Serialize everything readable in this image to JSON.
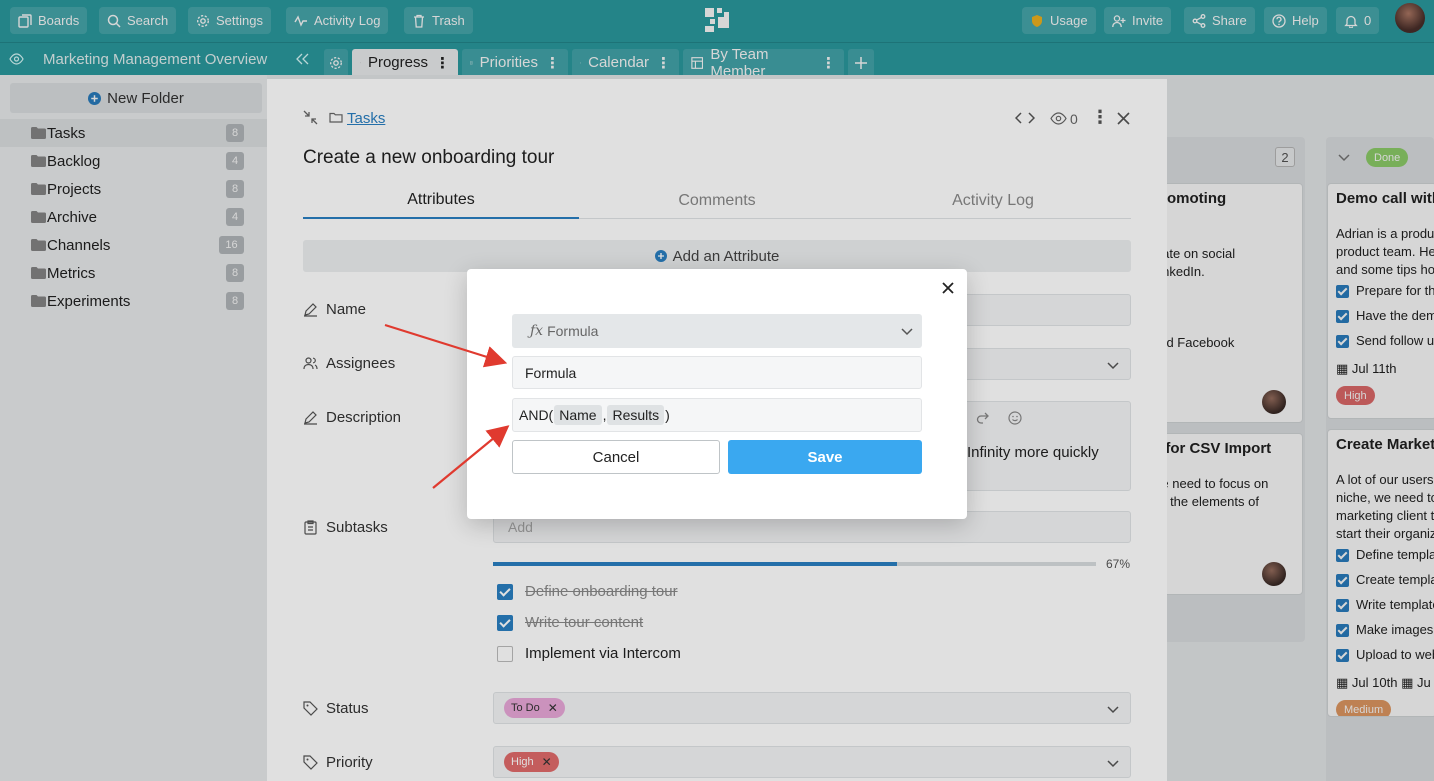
{
  "topbar": {
    "boards": "Boards",
    "search": "Search",
    "settings": "Settings",
    "activity_log": "Activity Log",
    "trash": "Trash",
    "usage": "Usage",
    "invite": "Invite",
    "share": "Share",
    "help": "Help",
    "notifications": "0"
  },
  "board_title": "Marketing Management Overview",
  "view_tabs": [
    "Progress",
    "Priorities",
    "Calendar",
    "By Team Member"
  ],
  "sidebar": {
    "new_folder": "New Folder",
    "items": [
      {
        "label": "Tasks",
        "count": "8"
      },
      {
        "label": "Backlog",
        "count": "4"
      },
      {
        "label": "Projects",
        "count": "8"
      },
      {
        "label": "Archive",
        "count": "4"
      },
      {
        "label": "Channels",
        "count": "16"
      },
      {
        "label": "Metrics",
        "count": "8"
      },
      {
        "label": "Experiments",
        "count": "8"
      }
    ]
  },
  "board": {
    "col_count": "2",
    "done_label": "Done",
    "card1_title": "promoting",
    "card1_l1": "plate on social",
    "card1_l2": "LinkedIn.",
    "card1_l3": "and Facebook",
    "card2_title": "n for CSV Import",
    "card2_l1": "we need to focus on",
    "card2_l2": "pe the elements of",
    "card3_title": "Demo call with",
    "card3_l1": "Adrian is a produ",
    "card3_l2": "product team. He",
    "card3_l3": "and some tips ho",
    "card3_c1": "Prepare for th",
    "card3_c2": "Have the dem",
    "card3_c3": "Send follow up",
    "card3_date": "Jul 11th",
    "card3_priority": "High",
    "card4_title": "Create Marketin",
    "card4_l1": "A lot of our users",
    "card4_l2": "niche, we need to",
    "card4_l3": "marketing client t",
    "card4_l4": "start their organiz",
    "card4_c1": "Define templa",
    "card4_c2": "Create templa",
    "card4_c3": "Write template",
    "card4_c4": "Make images",
    "card4_c5": "Upload to web",
    "card4_date": "Jul 10th",
    "card4_date2": "Ju",
    "card4_priority": "Medium"
  },
  "panel": {
    "breadcrumb": "Tasks",
    "watchers": "0",
    "title": "Create a new onboarding tour",
    "tabs": [
      "Attributes",
      "Comments",
      "Activity Log"
    ],
    "add_attribute": "Add an Attribute",
    "labels": {
      "name": "Name",
      "assignees": "Assignees",
      "description": "Description",
      "subtasks": "Subtasks",
      "status": "Status",
      "priority": "Priority"
    },
    "description_visible": "Infinity more quickly",
    "subtasks_placeholder": "Add",
    "progress_label": "67%",
    "progress": 0.67,
    "subtasks": [
      {
        "label": "Define onboarding tour",
        "done": true
      },
      {
        "label": "Write tour content",
        "done": true
      },
      {
        "label": "Implement via Intercom",
        "done": false
      }
    ],
    "status_value": "To Do",
    "priority_value": "High"
  },
  "modal": {
    "type_label": "Formula",
    "name_value": "Formula",
    "formula_fn": "AND(",
    "formula_arg1": "Name",
    "formula_sep": ",",
    "formula_arg2": "Results",
    "formula_close": ")",
    "cancel": "Cancel",
    "save": "Save"
  },
  "colors": {
    "topbar": "#2b9ea3",
    "accent": "#2a7fc1",
    "save_button": "#3aa8f0",
    "status_todo": "#e7a7d8",
    "priority_high": "#e06a6a",
    "done_badge": "#8fd16a",
    "annotation_arrow": "#e03a2f"
  }
}
